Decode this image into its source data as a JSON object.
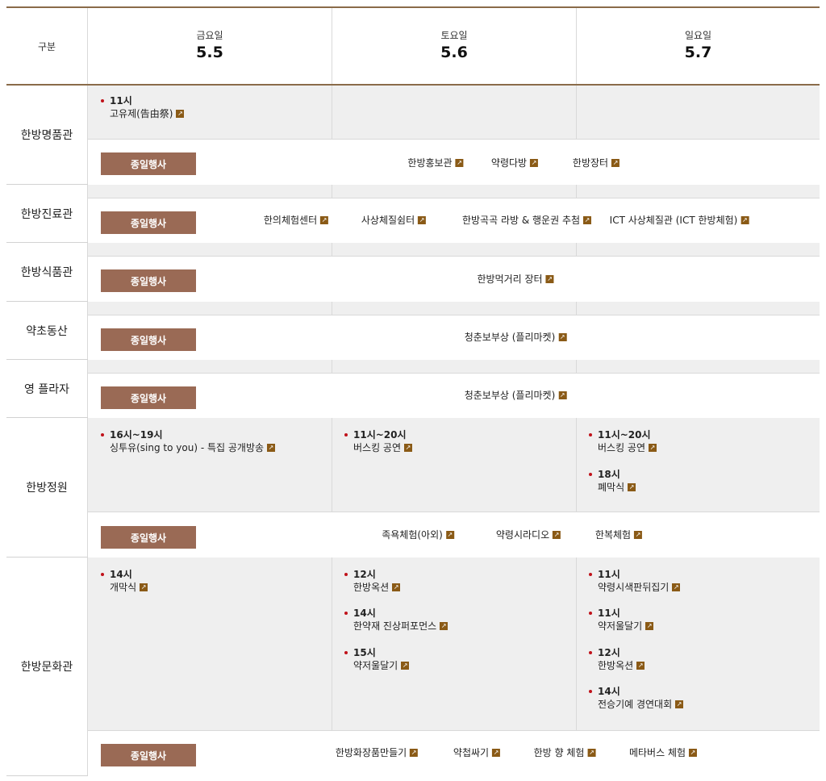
{
  "header": {
    "label": "구분",
    "days": [
      {
        "name": "금요일",
        "date": "5.5"
      },
      {
        "name": "토요일",
        "date": "5.6"
      },
      {
        "name": "일요일",
        "date": "5.7"
      }
    ]
  },
  "allday_label": "종일행사",
  "link_icon": "external-link-icon",
  "colors": {
    "accent": "#8a6b49",
    "button": "#9a6a55",
    "bullet": "#c0121a",
    "icon": "#8a5a16",
    "grey_cell": "#efefef"
  },
  "venues": [
    {
      "name": "한방명품관",
      "events": [
        [
          {
            "time": "11시",
            "name": "고유제(告由祭)"
          }
        ],
        [],
        []
      ],
      "allday": [
        "한방홍보관",
        "약령다방",
        "한방장터"
      ]
    },
    {
      "name": "한방진료관",
      "allday": [
        "한의체험센터",
        "사상체질쉼터",
        "한방곡곡 라방 & 행운권 추첨",
        "ICT 사상체질관 (ICT 한방체험)"
      ]
    },
    {
      "name": "한방식품관",
      "allday": [
        "한방먹거리 장터"
      ]
    },
    {
      "name": "약초동산",
      "allday": [
        "청춘보부상 (플리마켓)"
      ]
    },
    {
      "name": "영 플라자",
      "allday": [
        "청춘보부상 (플리마켓)"
      ]
    },
    {
      "name": "한방정원",
      "events": [
        [
          {
            "time": "16시~19시",
            "name": "싱투유(sing to you) - 특집 공개방송"
          }
        ],
        [
          {
            "time": "11시~20시",
            "name": "버스킹 공연"
          }
        ],
        [
          {
            "time": "11시~20시",
            "name": "버스킹 공연"
          },
          {
            "time": "18시",
            "name": "폐막식"
          }
        ]
      ],
      "allday": [
        "족욕체험(아외)",
        "약령시라디오",
        "한복체험"
      ]
    },
    {
      "name": "한방문화관",
      "events": [
        [
          {
            "time": "14시",
            "name": "개막식"
          }
        ],
        [
          {
            "time": "12시",
            "name": "한방옥션"
          },
          {
            "time": "14시",
            "name": "한약재 진상퍼포먼스"
          },
          {
            "time": "15시",
            "name": "약저울달기"
          }
        ],
        [
          {
            "time": "11시",
            "name": "약령시색판뒤집기"
          },
          {
            "time": "11시",
            "name": "약저울달기"
          },
          {
            "time": "12시",
            "name": "한방옥션"
          },
          {
            "time": "14시",
            "name": "전승기예 경연대회"
          }
        ]
      ],
      "allday": [
        "한방화장품만들기",
        "약첩싸기",
        "한방 향 체험",
        "메타버스 체험"
      ]
    }
  ]
}
